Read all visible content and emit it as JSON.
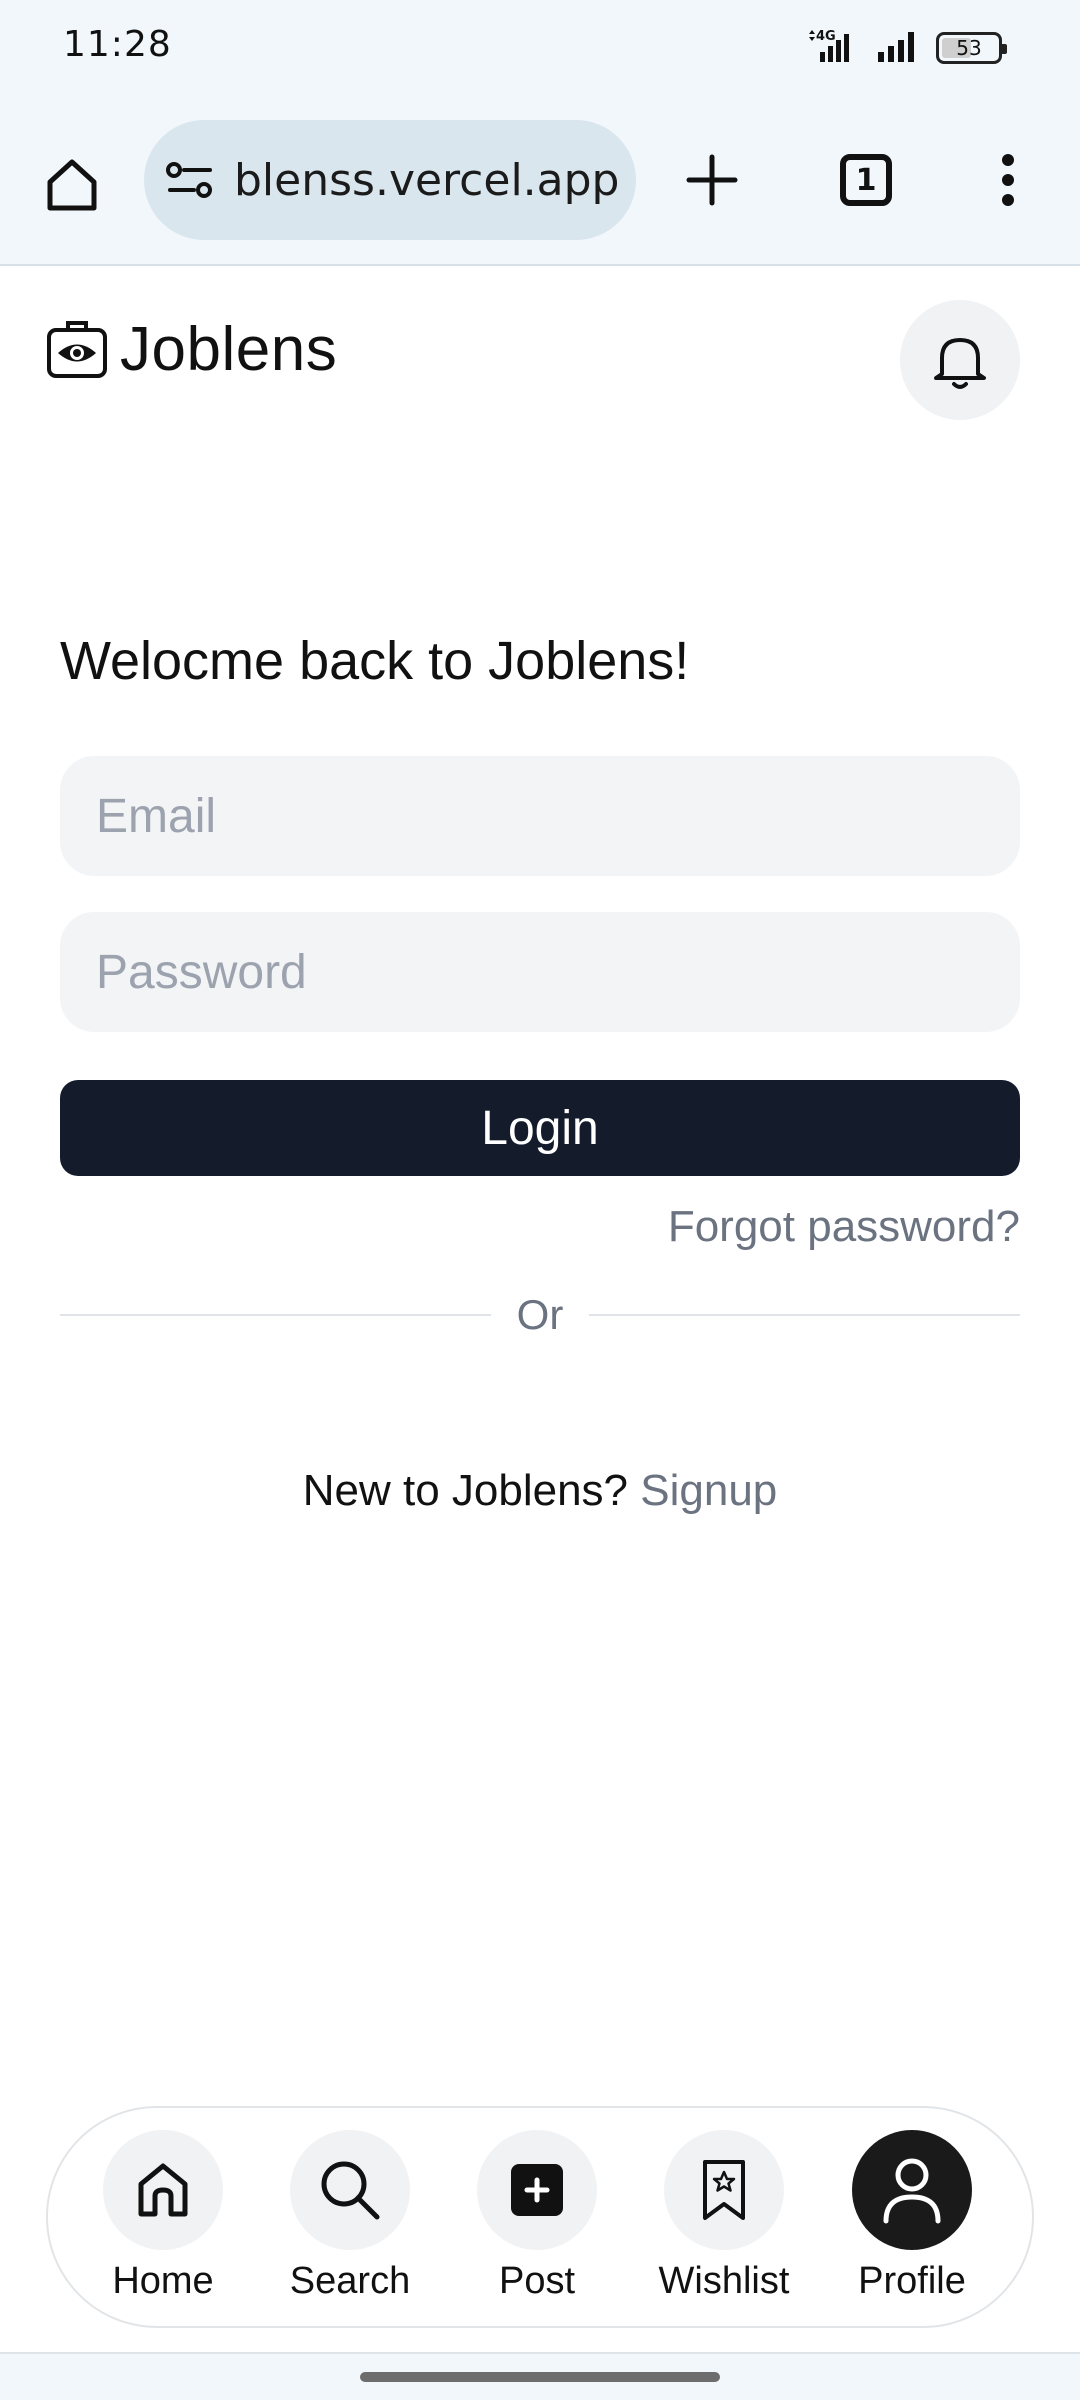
{
  "status_bar": {
    "time": "11:28",
    "network": "4G",
    "battery": "53",
    "battery_level": 0.53
  },
  "browser": {
    "url": "blenss.vercel.app",
    "tab_count": "1"
  },
  "header": {
    "brand": "Joblens"
  },
  "login": {
    "title": "Welocme back to Joblens!",
    "email_placeholder": "Email",
    "password_placeholder": "Password",
    "login_label": "Login",
    "forgot_label": "Forgot password?",
    "divider_label": "Or",
    "signup_prompt": "New to Joblens?",
    "signup_label": "Signup"
  },
  "nav": {
    "items": [
      {
        "label": "Home",
        "icon": "home-icon"
      },
      {
        "label": "Search",
        "icon": "search-icon"
      },
      {
        "label": "Post",
        "icon": "post-icon"
      },
      {
        "label": "Wishlist",
        "icon": "wishlist-icon"
      },
      {
        "label": "Profile",
        "icon": "profile-icon",
        "active": true
      }
    ]
  },
  "colors": {
    "primary_button": "#141b2b",
    "muted_text": "#6b7280",
    "input_bg": "#f3f4f6",
    "browser_bg": "#f2f7fb"
  }
}
